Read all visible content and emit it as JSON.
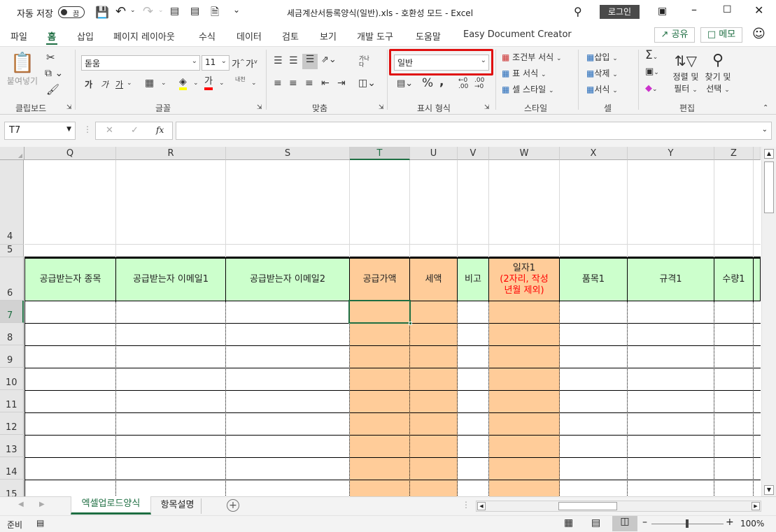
{
  "titlebar": {
    "autosave_label": "자동 저장",
    "autosave_state": "끔",
    "document_title": "세금계산서등록양식(일반).xls  -  호환성 모드  -  Excel",
    "login_label": "로그인"
  },
  "tabs": [
    "파일",
    "홈",
    "삽입",
    "페이지 레이아웃",
    "수식",
    "데이터",
    "검토",
    "보기",
    "개발 도구",
    "도움말",
    "Easy Document Creator"
  ],
  "active_tab": "홈",
  "share_label": "공유",
  "memo_label": "메모",
  "ribbon": {
    "clipboard": {
      "paste_label": "붙여넣기",
      "group_label": "클립보드"
    },
    "font": {
      "font_name": "돋움",
      "font_size": "11",
      "bold": "가",
      "italic": "가",
      "underline": "가",
      "font_color_glyph": "가",
      "phonetic": "내천",
      "group_label": "글꼴"
    },
    "alignment": {
      "wrap_glyph": "가나다",
      "group_label": "맞춤"
    },
    "number": {
      "format_value": "일반",
      "group_label": "표시 형식",
      "accent_color": "#e01010"
    },
    "styles": {
      "conditional": "조건부 서식",
      "table": "표 서식",
      "cell_style": "셀 스타일",
      "group_label": "스타일"
    },
    "cells": {
      "insert": "삽입",
      "delete": "삭제",
      "format": "서식",
      "group_label": "셀"
    },
    "editing": {
      "sort_filter_1": "정렬 및",
      "sort_filter_2": "필터",
      "find_select_1": "찾기 및",
      "find_select_2": "선택",
      "group_label": "편집"
    }
  },
  "formula_bar": {
    "name_box": "T7",
    "formula": "",
    "fx": "fx"
  },
  "columns": [
    "Q",
    "R",
    "S",
    "T",
    "U",
    "V",
    "W",
    "X",
    "Y",
    "Z"
  ],
  "selected_column": "T",
  "rows": [
    "4",
    "5",
    "6",
    "7",
    "8",
    "9",
    "10",
    "11",
    "12",
    "13",
    "14",
    "15"
  ],
  "selected_row": "7",
  "header_cells": [
    {
      "col": "Q",
      "text": "공급받는자 종목",
      "bg": "#ccffcc",
      "color": "#000000"
    },
    {
      "col": "R",
      "text": "공급받는자 이메일1",
      "bg": "#ccffcc",
      "color": "#000000"
    },
    {
      "col": "S",
      "text": "공급받는자 이메일2",
      "bg": "#ccffcc",
      "color": "#000000"
    },
    {
      "col": "T",
      "text": "공급가액",
      "bg": "#ffcc99",
      "color": "#000000"
    },
    {
      "col": "U",
      "text": "세액",
      "bg": "#ffcc99",
      "color": "#000000"
    },
    {
      "col": "V",
      "text": "비고",
      "bg": "#ccffcc",
      "color": "#000000"
    },
    {
      "col": "W",
      "text": "일자1",
      "text2": "(2자리, 작성",
      "text3": "년월 제외)",
      "bg": "#ffcc99",
      "color": "#000000",
      "color2": "#ff0000"
    },
    {
      "col": "X",
      "text": "품목1",
      "bg": "#ccffcc",
      "color": "#000000"
    },
    {
      "col": "Y",
      "text": "규격1",
      "bg": "#ccffcc",
      "color": "#000000"
    },
    {
      "col": "Z",
      "text": "수량1",
      "bg": "#ccffcc",
      "color": "#000000"
    }
  ],
  "sheet_tabs": [
    "엑셀업로드양식",
    "항목설명"
  ],
  "active_sheet": "엑셀업로드양식",
  "status": {
    "ready": "준비",
    "zoom": "100%"
  }
}
